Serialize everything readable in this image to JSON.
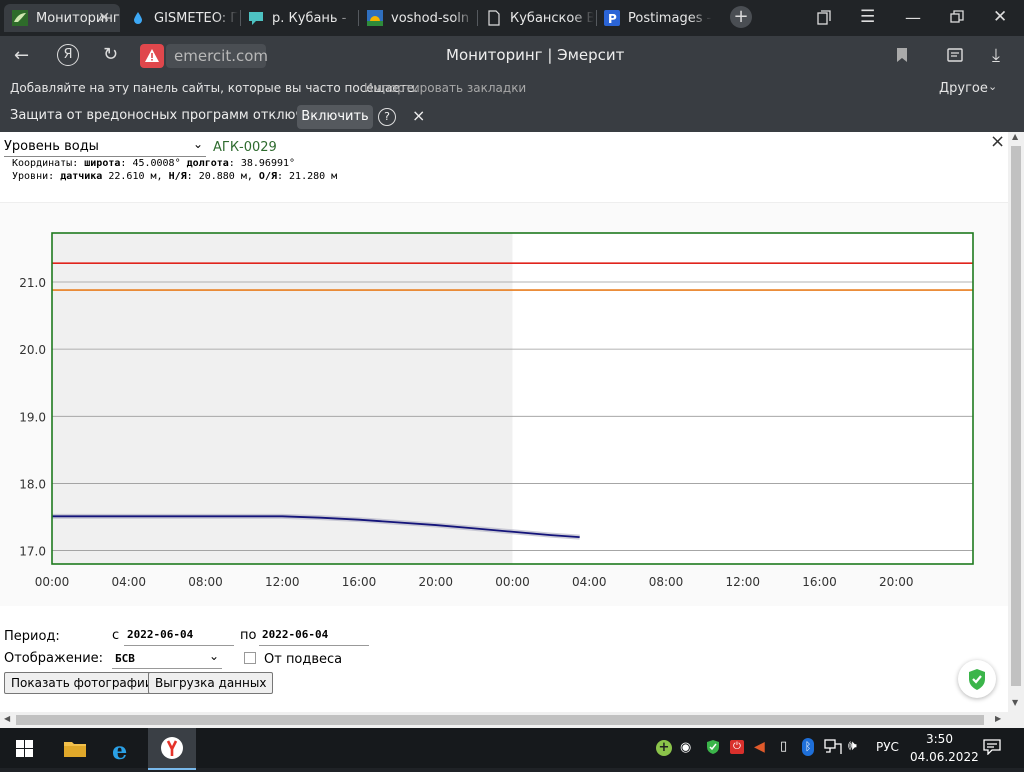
{
  "tabs": [
    {
      "title": "Мониторинг",
      "active": true,
      "icon": "leaf-icon"
    },
    {
      "title": "GISMETEO: Г",
      "icon": "water-drop-icon"
    },
    {
      "title": "р. Кубань - ",
      "icon": "chat-bubble-icon"
    },
    {
      "title": "voshod-soln",
      "icon": "sunrise-icon"
    },
    {
      "title": "Кубанское В",
      "icon": "document-icon"
    },
    {
      "title": "Postimages -",
      "icon": "postimages-icon"
    }
  ],
  "toolbar": {
    "url": "emercit.com",
    "page_title": "Мониторинг | Эмерсит"
  },
  "bookmarks": {
    "hint": "Добавляйте на эту панель сайты, которые вы часто посещаете.",
    "import_link": "Импортировать закладки",
    "other": "Другое"
  },
  "warning": {
    "text": "Защита от вредоносных программ отключена",
    "enable_button": "Включить",
    "help": "?",
    "close": "×"
  },
  "panel": {
    "parameter_select": "Уровень воды",
    "station": "АГК-0029",
    "coords_prefix": "Координаты:",
    "lat_label": "широта",
    "lat_value": "45.0008°",
    "lon_label": "долгота",
    "lon_value": "38.96991°",
    "levels_prefix": "Уровни:",
    "sensor_label": "датчика",
    "sensor_value": "22.610 м,",
    "ny_label": "Н/Я",
    "ny_value": "20.880 м,",
    "oy_label": "О/Я",
    "oy_value": "21.280 м",
    "close": "×"
  },
  "chart_data": {
    "type": "line",
    "y_ticks": [
      "21.0",
      "20.0",
      "19.0",
      "18.0",
      "17.0"
    ],
    "ylim": [
      16.8,
      21.73
    ],
    "x_tick_labels": [
      "00:00",
      "04:00",
      "08:00",
      "12:00",
      "16:00",
      "20:00",
      "00:00",
      "04:00",
      "08:00",
      "12:00",
      "16:00",
      "20:00"
    ],
    "x_hours_range": [
      0,
      48
    ],
    "shaded_until_hour": 24,
    "thresholds": [
      {
        "value": 21.28,
        "color": "#e0241c"
      },
      {
        "value": 20.88,
        "color": "#e87d1e"
      }
    ],
    "series": [
      {
        "color": "#14147a",
        "x_hours": [
          0,
          2,
          4,
          6,
          8,
          10,
          12,
          14,
          16,
          18,
          20,
          22,
          24,
          26,
          27.5
        ],
        "values": [
          17.51,
          17.51,
          17.51,
          17.51,
          17.51,
          17.51,
          17.51,
          17.49,
          17.46,
          17.42,
          17.38,
          17.33,
          17.28,
          17.23,
          17.2
        ]
      }
    ]
  },
  "controls": {
    "period_label": "Период:",
    "from_label": "с",
    "from_value": "2022-06-04",
    "to_label": "по",
    "to_value": "2022-06-04",
    "display_label": "Отображение:",
    "display_value": "БСВ",
    "from_suspension_label": "От подвеса",
    "from_suspension_checked": false,
    "show_photos_button": "Показать фотографии",
    "export_button": "Выгрузка данных"
  },
  "taskbar": {
    "language": "РУС",
    "time": "3:50",
    "date": "04.06.2022"
  }
}
